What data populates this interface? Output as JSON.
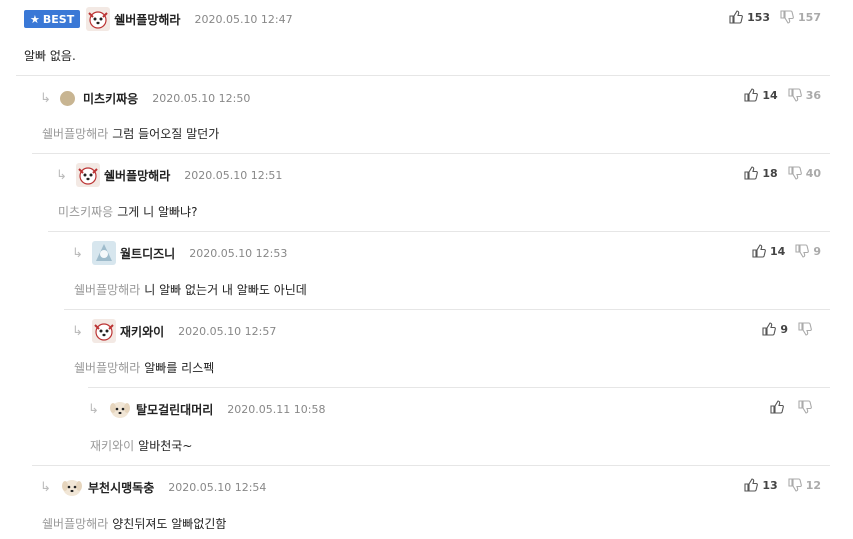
{
  "best_label": "BEST",
  "comments": [
    {
      "nick": "쉘버플망해라",
      "time": "2020.05.10 12:47",
      "up": "153",
      "down": "157",
      "mention": "",
      "text": "알빠 없음."
    },
    {
      "nick": "미츠키짜응",
      "time": "2020.05.10 12:50",
      "up": "14",
      "down": "36",
      "mention": "쉘버플망해라",
      "text": "그럼 들어오질 말던가"
    },
    {
      "nick": "쉘버플망해라",
      "time": "2020.05.10 12:51",
      "up": "18",
      "down": "40",
      "mention": "미츠키짜응",
      "text": "그게 니 알빠냐?"
    },
    {
      "nick": "월트디즈니",
      "time": "2020.05.10 12:53",
      "up": "14",
      "down": "9",
      "mention": "쉘버플망해라",
      "text": "니 알빠 없는거 내 알빠도 아닌데"
    },
    {
      "nick": "재키와이",
      "time": "2020.05.10 12:57",
      "up": "9",
      "down": "",
      "mention": "쉘버플망해라",
      "text": "알빠를 리스펙"
    },
    {
      "nick": "탈모걸린대머리",
      "time": "2020.05.11 10:58",
      "up": "",
      "down": "",
      "mention": "재키와이",
      "text": "알바천국~"
    },
    {
      "nick": "부천시맹독충",
      "time": "2020.05.10 12:54",
      "up": "13",
      "down": "12",
      "mention": "쉘버플망해라",
      "text": "양친뒤져도 알빠없긴함"
    }
  ],
  "colors": {
    "best_badge": "#3a78d6",
    "mention": "#999999",
    "divider": "#e6e6e6"
  }
}
